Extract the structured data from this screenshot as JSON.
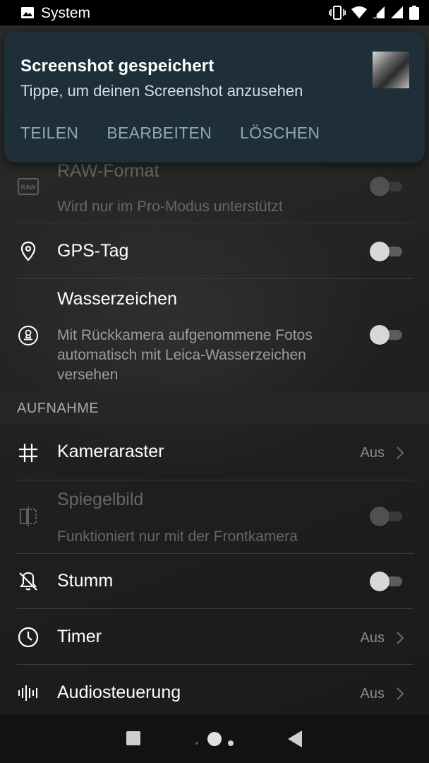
{
  "status_bar": {
    "app_name": "System",
    "icons": [
      "image-icon",
      "vibrate-icon",
      "wifi-icon",
      "signal-icon",
      "signal-icon",
      "battery-icon"
    ]
  },
  "notification": {
    "title": "Screenshot gespeichert",
    "subtitle": "Tippe, um deinen Screenshot anzusehen",
    "actions": {
      "share": "TEILEN",
      "edit": "BEARBEITEN",
      "delete": "LÖSCHEN"
    }
  },
  "settings": {
    "raw": {
      "title": "RAW-Format",
      "subtitle": "Wird nur im Pro-Modus unterstützt",
      "enabled": false,
      "icon": "raw-icon"
    },
    "gps": {
      "title": "GPS-Tag",
      "enabled": false,
      "icon": "location-pin-icon"
    },
    "watermark": {
      "title": "Wasserzeichen",
      "subtitle": "Mit Rückkamera aufgenommene Fotos automatisch mit Leica-Wasserzeichen versehen",
      "enabled": false,
      "icon": "stamp-icon"
    },
    "section_capture": "AUFNAHME",
    "grid": {
      "title": "Kameraraster",
      "value": "Aus",
      "icon": "grid-icon"
    },
    "mirror": {
      "title": "Spiegelbild",
      "subtitle": "Funktioniert nur mit der Frontkamera",
      "enabled": false,
      "icon": "mirror-icon"
    },
    "mute": {
      "title": "Stumm",
      "enabled": false,
      "icon": "mute-icon"
    },
    "timer": {
      "title": "Timer",
      "value": "Aus",
      "icon": "clock-icon"
    },
    "audio": {
      "title": "Audiosteuerung",
      "value": "Aus",
      "icon": "sound-wave-icon"
    }
  },
  "colors": {
    "notification_bg": "#1e2f39",
    "action_text": "#8fa7b6",
    "background": "#1c1c1c"
  }
}
